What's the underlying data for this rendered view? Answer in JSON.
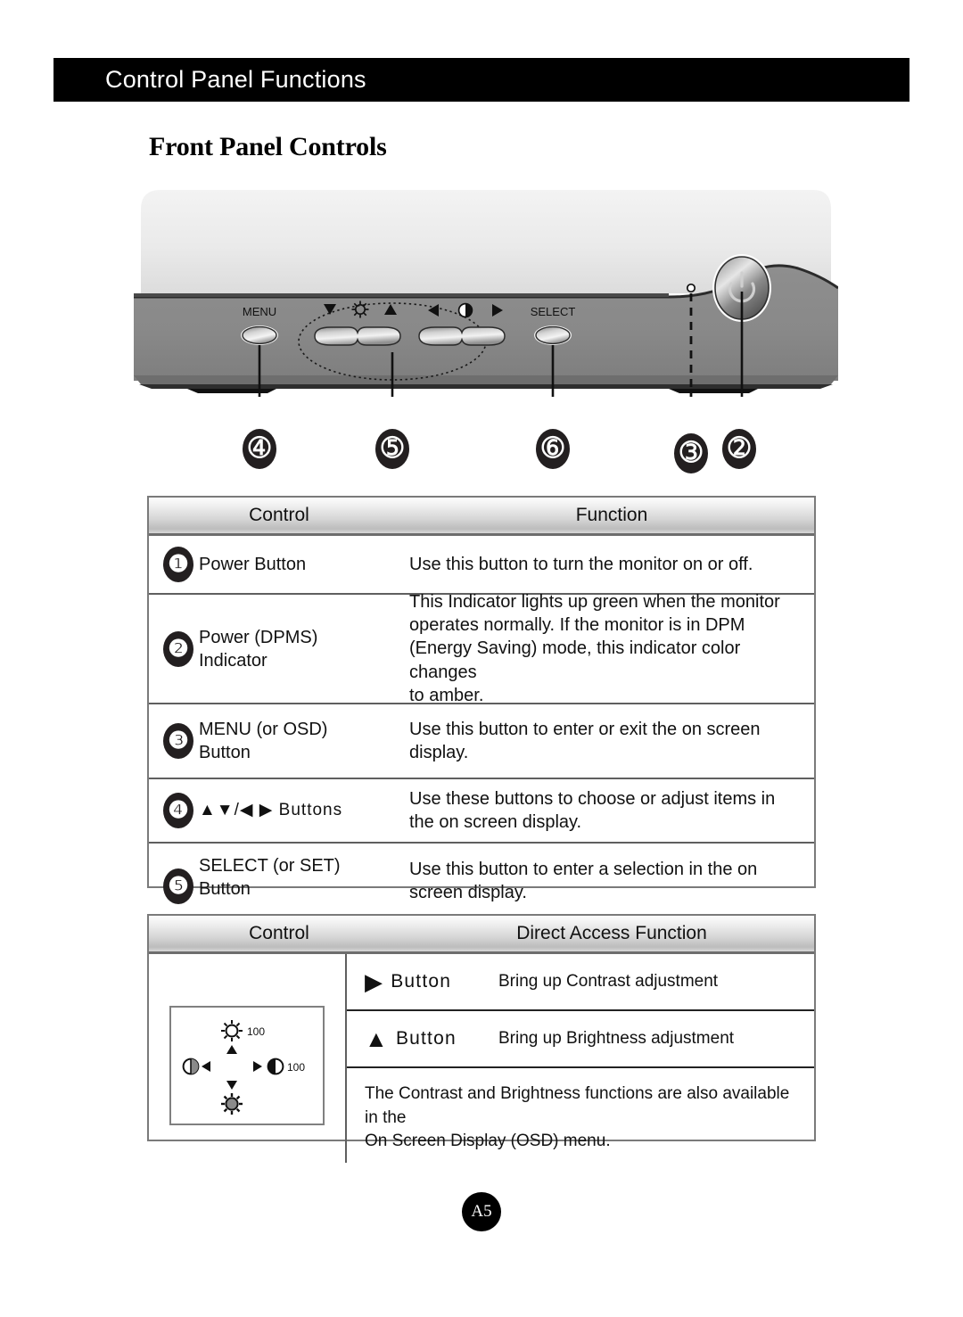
{
  "header": {
    "title": "Control Panel Functions"
  },
  "page_title": "Front Panel Controls",
  "monitor": {
    "labels": {
      "menu": "MENU",
      "select": "SELECT",
      "brightness_icon": "brightness-sun-icon",
      "contrast_icon": "contrast-half-circle-icon",
      "power_icon": "power-symbol-icon",
      "led_icon": "led-indicator-icon"
    },
    "callouts": [
      {
        "number": "➃",
        "label": "callout-3"
      },
      {
        "number": "➄",
        "label": "callout-4"
      },
      {
        "number": "➅",
        "label": "callout-5"
      },
      {
        "number": "➂",
        "label": "callout-2"
      },
      {
        "number": "➁",
        "label": "callout-1"
      }
    ]
  },
  "table1": {
    "headers": {
      "control": "Control",
      "function": "Function"
    },
    "rows": [
      {
        "num": "❶",
        "control": "Power Button",
        "function": "Use this button to turn the monitor on or off."
      },
      {
        "num": "❷",
        "control": "Power (DPMS)\nIndicator",
        "function": "This Indicator lights up green when the monitor\noperates normally. If the monitor is in DPM\n(Energy Saving) mode, this indicator color changes\nto amber."
      },
      {
        "num": "❸",
        "control": "MENU (or OSD)\nButton",
        "function": "Use this button to enter or exit the on screen\ndisplay."
      },
      {
        "num": "❹",
        "control": "▲▼/◀ ▶ Buttons",
        "function": "Use these buttons to choose or adjust items in\nthe on screen display."
      },
      {
        "num": "❺",
        "control": "SELECT (or SET)\n Button",
        "function": "Use this button to enter a selection in the on\nscreen display."
      }
    ]
  },
  "table2": {
    "headers": {
      "control": "Control",
      "function": "Direct Access Function"
    },
    "osd_diagram": {
      "top_icon": "brightness-sun-icon",
      "top_value": "100",
      "right_icon": "contrast-half-circle-icon",
      "right_value": "100",
      "left_icon": "contrast-half-circle-icon",
      "bottom_icon": "brightness-sun-filled-icon",
      "up_arrow": "▲",
      "down_arrow": "▼",
      "left_arrow": "◀",
      "right_arrow": "▶"
    },
    "rows": [
      {
        "glyph": "▶",
        "button_label": "Button",
        "desc": "Bring up Contrast adjustment"
      },
      {
        "glyph": "▲",
        "button_label": "Button",
        "desc": "Bring up Brightness adjustment"
      }
    ],
    "note": "The Contrast and Brightness functions are also available in the\nOn Screen Display (OSD) menu."
  },
  "page_badge": "A5",
  "colors": {
    "header_bar": "#000000",
    "table_border": "#7a7a7a",
    "badge_fill": "#231f20",
    "bezel_light": "#e8e8e8",
    "bezel_dark": "#868686"
  }
}
